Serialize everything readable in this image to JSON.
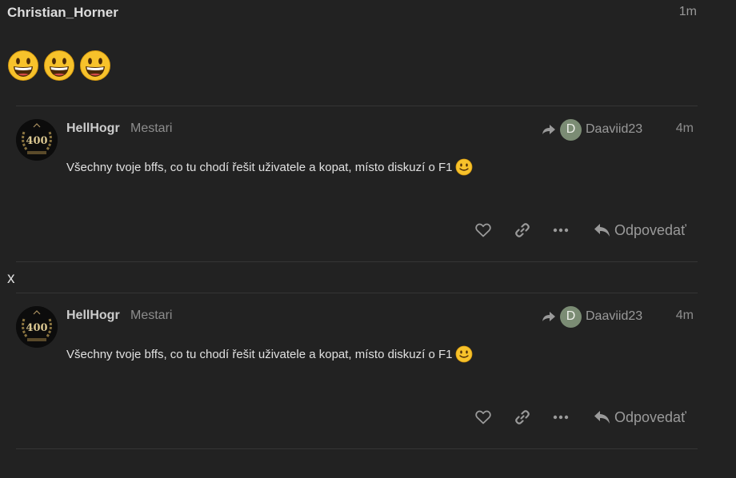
{
  "post": {
    "username": "Christian_Horner",
    "time": "1m",
    "emojis": [
      "grinning-face",
      "grinning-face",
      "grinning-face"
    ]
  },
  "separator_text": "x",
  "quotes": [
    {
      "username": "HellHogr",
      "group": "Mestari",
      "avatar_badge": "400",
      "reply_to_initial": "D",
      "reply_to_name": "Daaviid23",
      "time": "4m",
      "text": "Všechny tvoje bffs, co tu chodí řešit uživatele a kopat, místo diskuzí o F1",
      "text_emoji": "slightly-smiling-face",
      "reply_label": "Odpovedať"
    },
    {
      "username": "HellHogr",
      "group": "Mestari",
      "avatar_badge": "400",
      "reply_to_initial": "D",
      "reply_to_name": "Daaviid23",
      "time": "4m",
      "text": "Všechny tvoje bffs, co tu chodí řešit uživatele a kopat, místo diskuzí o F1",
      "text_emoji": "slightly-smiling-face",
      "reply_label": "Odpovedať"
    }
  ],
  "colors": {
    "background": "#222222",
    "text": "#dddddd",
    "muted": "#8d8d8d",
    "divider": "#353535",
    "reply_avatar": "#7b8c74",
    "emoji_face": "#f7c22b"
  }
}
